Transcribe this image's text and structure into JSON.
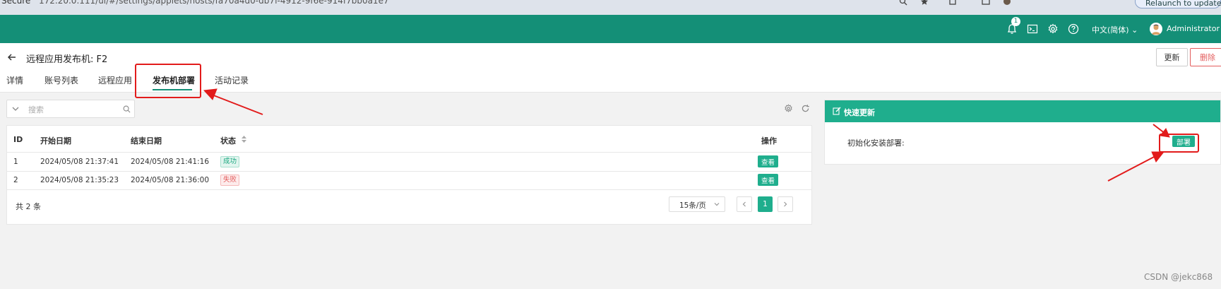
{
  "browser": {
    "security_label": "Secure",
    "url": "172.20.0.111/ui/#/settings/applets/hosts/fa70a4d0-db7f-4912-9f6e-914f7bb0a1e7",
    "relaunch_label": "Relaunch to update"
  },
  "header": {
    "notification_count": "1",
    "language": "中文(简体)",
    "username": "Administrator",
    "brand_color": "#148f77"
  },
  "page": {
    "title": "远程应用发布机: F2",
    "update_label": "更新",
    "delete_label": "删除",
    "tabs": [
      {
        "label": "详情"
      },
      {
        "label": "账号列表"
      },
      {
        "label": "远程应用"
      },
      {
        "label": "发布机部署",
        "active": true
      },
      {
        "label": "活动记录"
      }
    ]
  },
  "search": {
    "placeholder": "搜索",
    "value": ""
  },
  "table": {
    "columns": [
      "ID",
      "开始日期",
      "结束日期",
      "状态",
      "操作"
    ],
    "rows": [
      {
        "id": "1",
        "start": "2024/05/08 21:37:41",
        "end": "2024/05/08 21:41:16",
        "status": "成功",
        "status_type": "success",
        "action": "查看"
      },
      {
        "id": "2",
        "start": "2024/05/08 21:35:23",
        "end": "2024/05/08 21:36:00",
        "status": "失败",
        "status_type": "fail",
        "action": "查看"
      }
    ],
    "total_label": "共 2 条",
    "page_size": "15条/页",
    "current_page": "1"
  },
  "quick_update": {
    "title": "快速更新",
    "item_label": "初始化安装部署:",
    "button_label": "部署"
  },
  "watermark": "CSDN @jekc868",
  "icons": {
    "back": "arrow-left-icon",
    "bell": "bell-icon",
    "terminal": "terminal-icon",
    "settings": "gear-icon",
    "help": "help-icon",
    "search": "search-icon",
    "refresh": "refresh-icon",
    "edit": "edit-icon"
  }
}
